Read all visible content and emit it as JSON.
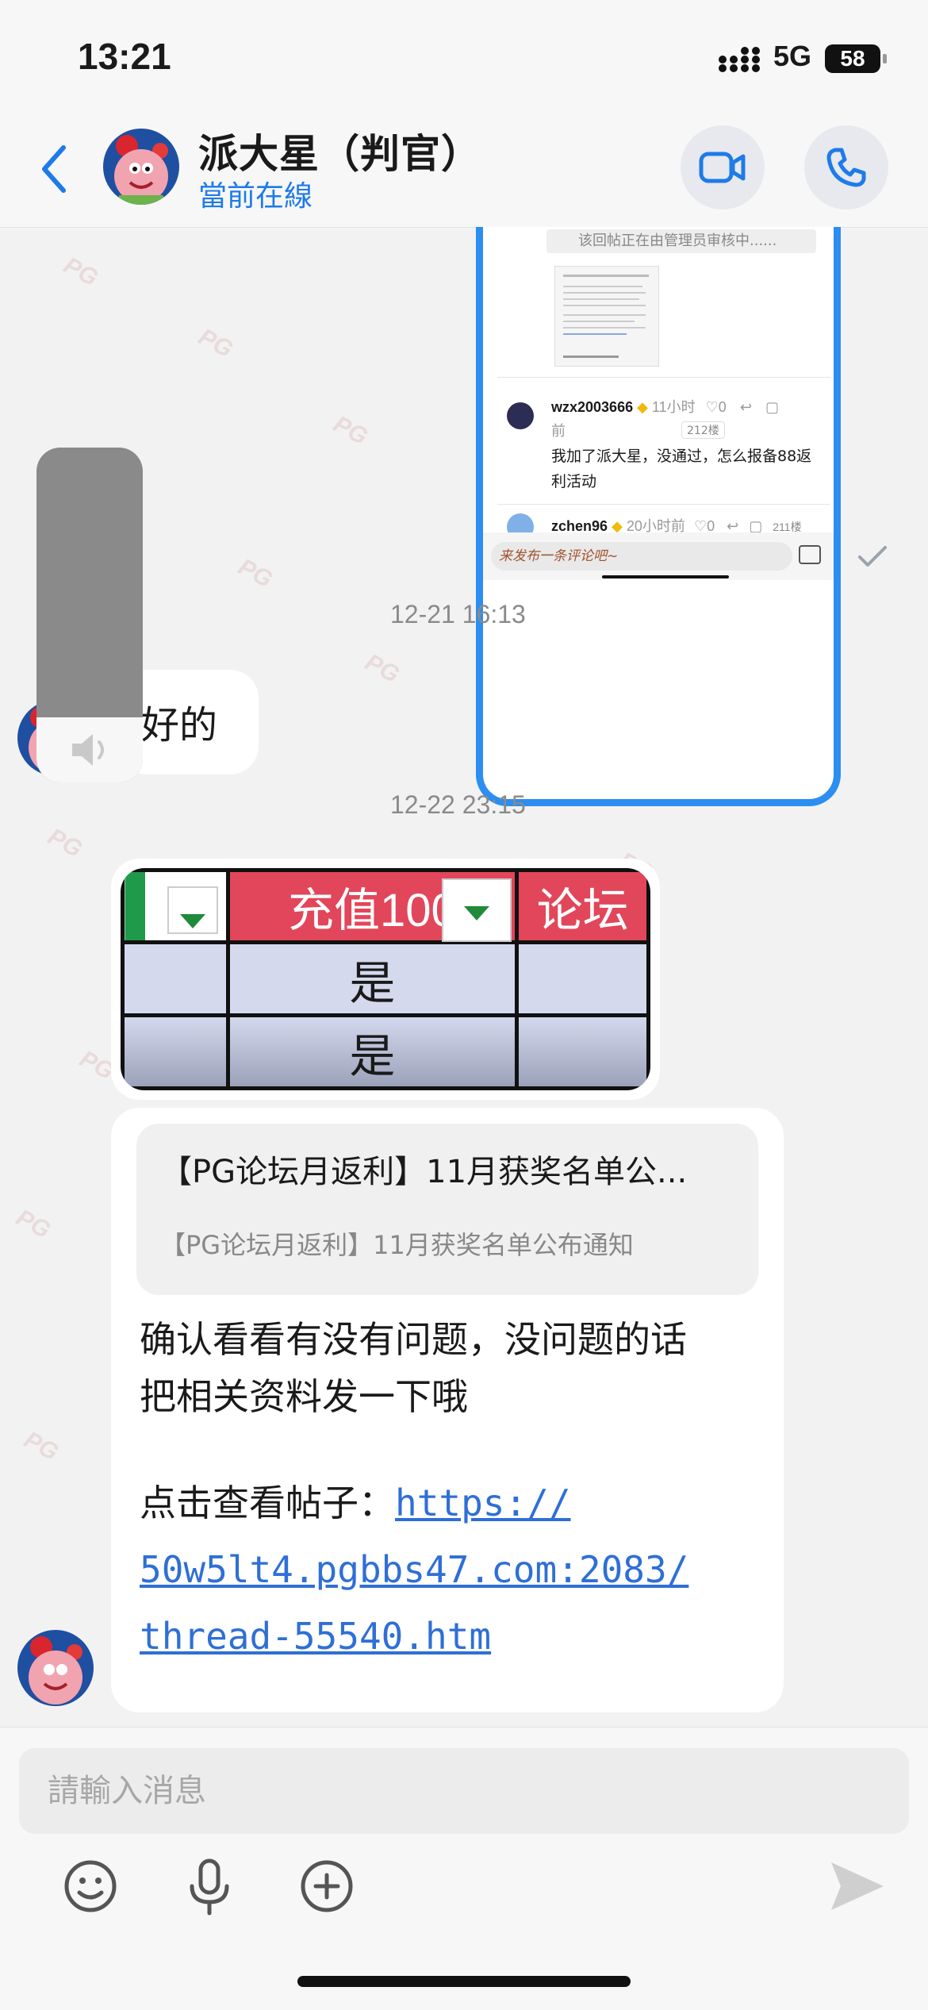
{
  "status_bar": {
    "time": "13:21",
    "network": "5G",
    "battery": "58"
  },
  "header": {
    "contact_name": "派大星（判官）",
    "contact_status": "當前在線"
  },
  "shared_screenshot": {
    "notice": "该回帖正在由管理员审核中......",
    "comment1_user": "wzx2003666",
    "comment1_time": "11小时",
    "comment1_time_suffix": "前",
    "comment1_likes": "0",
    "comment1_floor": "212楼",
    "comment1_text": "我加了派大星，没通过，怎么报备88返利活动",
    "comment2_user": "zchen96",
    "comment2_time": "20小时前",
    "comment2_likes": "0",
    "comment2_floor": "211楼",
    "comment_placeholder": "来发布一条评论吧~"
  },
  "messages": {
    "ts1": "12-21 16:13",
    "msg1": "好的",
    "ts2": "12-22 23:15",
    "table": {
      "headers": [
        "",
        "充值100",
        "论坛"
      ],
      "rows": [
        [
          "",
          "是",
          ""
        ],
        [
          "",
          "是",
          ""
        ]
      ]
    },
    "card_title": "【PG论坛月返利】11月获奖名单公...",
    "card_desc": "【PG论坛月返利】11月获奖名单公布通知",
    "msg2_line1": "确认看看有没有问题，没问题的话",
    "msg2_line2": "把相关资料发一下哦",
    "msg2_link_prefix": "点击查看帖子：",
    "link_part1": "https://",
    "link_part2": "50w5lt4.pgbbs47.com:2083/",
    "link_part3": "thread-55540.htm"
  },
  "input": {
    "placeholder": "請輸入消息"
  },
  "watermark": "PG",
  "colors": {
    "accent": "#1e7be8",
    "frame": "#2b8ef0",
    "table_header": "#e2465a",
    "table_row": "#d4d9ee"
  }
}
